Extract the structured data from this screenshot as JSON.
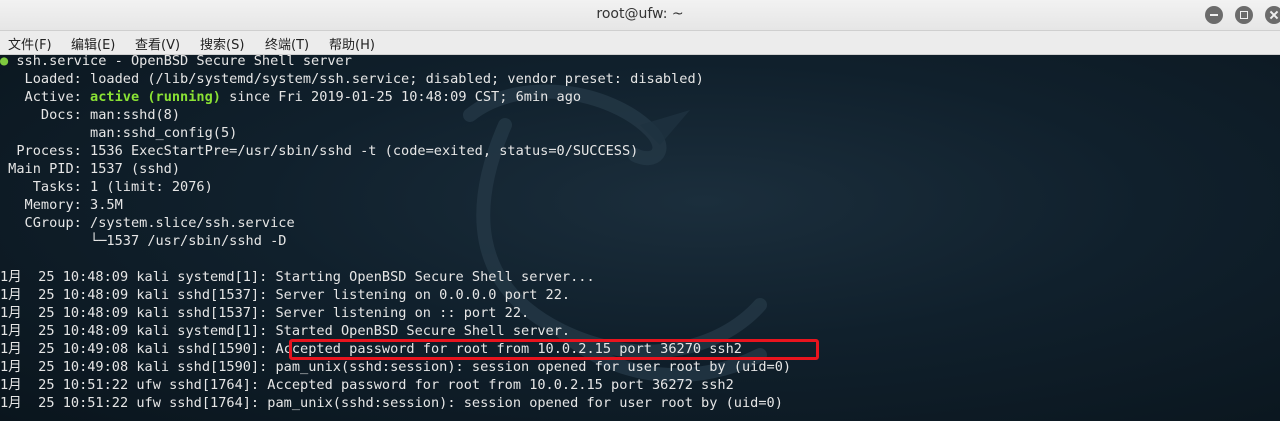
{
  "window": {
    "title": "root@ufw: ~"
  },
  "menu": [
    "文件(F)",
    "编辑(E)",
    "查看(V)",
    "搜索(S)",
    "终端(T)",
    "帮助(H)"
  ],
  "status": {
    "bullet": "●",
    "header": "ssh.service - OpenBSD Secure Shell server",
    "loaded": "   Loaded: loaded (/lib/systemd/system/ssh.service; disabled; vendor preset: disabled)",
    "active_prefix": "   Active: ",
    "active_state": "active (running)",
    "active_suffix": " since Fri 2019-01-25 10:48:09 CST; 6min ago",
    "docs1": "     Docs: man:sshd(8)",
    "docs2": "           man:sshd_config(5)",
    "process": "  Process: 1536 ExecStartPre=/usr/sbin/sshd -t (code=exited, status=0/SUCCESS)",
    "main_pid": " Main PID: 1537 (sshd)",
    "tasks": "    Tasks: 1 (limit: 2076)",
    "memory": "   Memory: 3.5M",
    "cgroup": "   CGroup: /system.slice/ssh.service",
    "cgroup_child": "           └─1537 /usr/sbin/sshd -D"
  },
  "log": [
    "1月  25 10:48:09 kali systemd[1]: Starting OpenBSD Secure Shell server...",
    "1月  25 10:48:09 kali sshd[1537]: Server listening on 0.0.0.0 port 22.",
    "1月  25 10:48:09 kali sshd[1537]: Server listening on :: port 22.",
    "1月  25 10:48:09 kali systemd[1]: Started OpenBSD Secure Shell server.",
    "1月  25 10:49:08 kali sshd[1590]: Accepted password for root from 10.0.2.15 port 36270 ssh2",
    "1月  25 10:49:08 kali sshd[1590]: pam_unix(sshd:session): session opened for user root by (uid=0)",
    "1月  25 10:51:22 ufw sshd[1764]: Accepted password for root from 10.0.2.15 port 36272 ssh2",
    "1月  25 10:51:22 ufw sshd[1764]: pam_unix(sshd:session): session opened for user root by (uid=0)"
  ],
  "colors": {
    "active_green": "#8ae234",
    "highlight_red": "#e8141e",
    "terminal_bg": "#10202c"
  }
}
